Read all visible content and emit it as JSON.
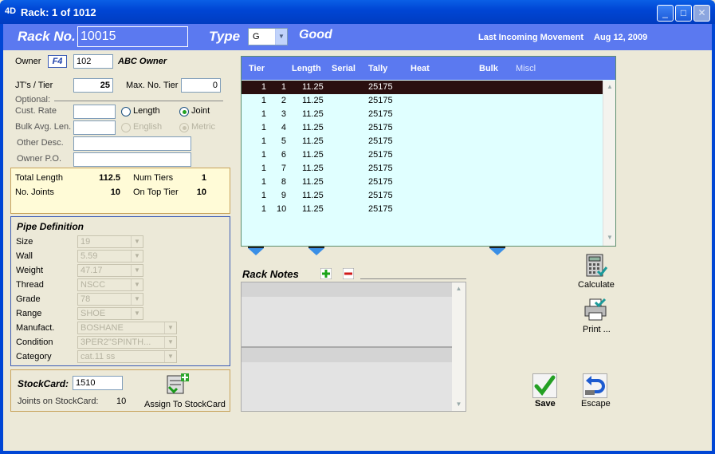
{
  "window": {
    "icon": "4D",
    "title": "Rack: 1 of 1012"
  },
  "header": {
    "rack_label": "Rack No.",
    "rack_no": "10015",
    "type_label": "Type",
    "type_value": "G",
    "type_desc": "Good",
    "last_movement_label": "Last Incoming Movement",
    "last_movement_date": "Aug 12, 2009"
  },
  "owner": {
    "label": "Owner",
    "key_label": "F4",
    "code": "102",
    "name": "ABC Owner"
  },
  "jts_tier": {
    "label": "JT's / Tier",
    "value": "25"
  },
  "max_tier": {
    "label": "Max. No. Tier",
    "value": "0"
  },
  "optional_label": "Optional:",
  "cust_rate": {
    "label": "Cust. Rate",
    "value": ""
  },
  "bulk_avg_len": {
    "label": "Bulk Avg. Len.",
    "value": ""
  },
  "rate_mode": {
    "length_label": "Length",
    "joint_label": "Joint",
    "selected": "Joint"
  },
  "units": {
    "english_label": "English",
    "metric_label": "Metric",
    "selected": "Metric"
  },
  "other_desc": {
    "label": "Other Desc.",
    "value": ""
  },
  "owner_po": {
    "label": "Owner P.O.",
    "value": ""
  },
  "totals": {
    "total_length_label": "Total Length",
    "total_length": "112.5",
    "num_tiers_label": "Num Tiers",
    "num_tiers": "1",
    "no_joints_label": "No. Joints",
    "no_joints": "10",
    "on_top_tier_label": "On Top Tier",
    "on_top_tier": "10"
  },
  "pipe": {
    "title": "Pipe Definition",
    "fields": [
      {
        "label": "Size",
        "value": "19"
      },
      {
        "label": "Wall",
        "value": "5.59"
      },
      {
        "label": "Weight",
        "value": "47.17"
      },
      {
        "label": "Thread",
        "value": "NSCC"
      },
      {
        "label": "Grade",
        "value": "78"
      },
      {
        "label": "Range",
        "value": "SHOE"
      },
      {
        "label": "Manufact.",
        "value": "BOSHANE"
      },
      {
        "label": "Condition",
        "value": "3PER2\"SPINTH..."
      },
      {
        "label": "Category",
        "value": "cat.11 ss"
      }
    ]
  },
  "stockcard": {
    "label": "StockCard:",
    "value": "1510",
    "joints_label": "Joints on StockCard:",
    "joints_value": "10",
    "assign_label": "Assign To StockCard"
  },
  "grid": {
    "columns": [
      "Tier",
      "Length",
      "Serial",
      "Tally",
      "Heat",
      "Bulk",
      "Miscl"
    ],
    "rows": [
      {
        "tier": "1",
        "joint": "1",
        "length": "11.25",
        "tally": "25175"
      },
      {
        "tier": "1",
        "joint": "2",
        "length": "11.25",
        "tally": "25175"
      },
      {
        "tier": "1",
        "joint": "3",
        "length": "11.25",
        "tally": "25175"
      },
      {
        "tier": "1",
        "joint": "4",
        "length": "11.25",
        "tally": "25175"
      },
      {
        "tier": "1",
        "joint": "5",
        "length": "11.25",
        "tally": "25175"
      },
      {
        "tier": "1",
        "joint": "6",
        "length": "11.25",
        "tally": "25175"
      },
      {
        "tier": "1",
        "joint": "7",
        "length": "11.25",
        "tally": "25175"
      },
      {
        "tier": "1",
        "joint": "8",
        "length": "11.25",
        "tally": "25175"
      },
      {
        "tier": "1",
        "joint": "9",
        "length": "11.25",
        "tally": "25175"
      },
      {
        "tier": "1",
        "joint": "10",
        "length": "11.25",
        "tally": "25175"
      }
    ]
  },
  "notes": {
    "title": "Rack Notes"
  },
  "buttons": {
    "calculate": "Calculate",
    "print": "Print ...",
    "save": "Save",
    "escape": "Escape"
  },
  "colors": {
    "header_blue": "#5b79f0",
    "grid_bg": "#e0ffff",
    "totals_bg": "#fffbd7"
  }
}
